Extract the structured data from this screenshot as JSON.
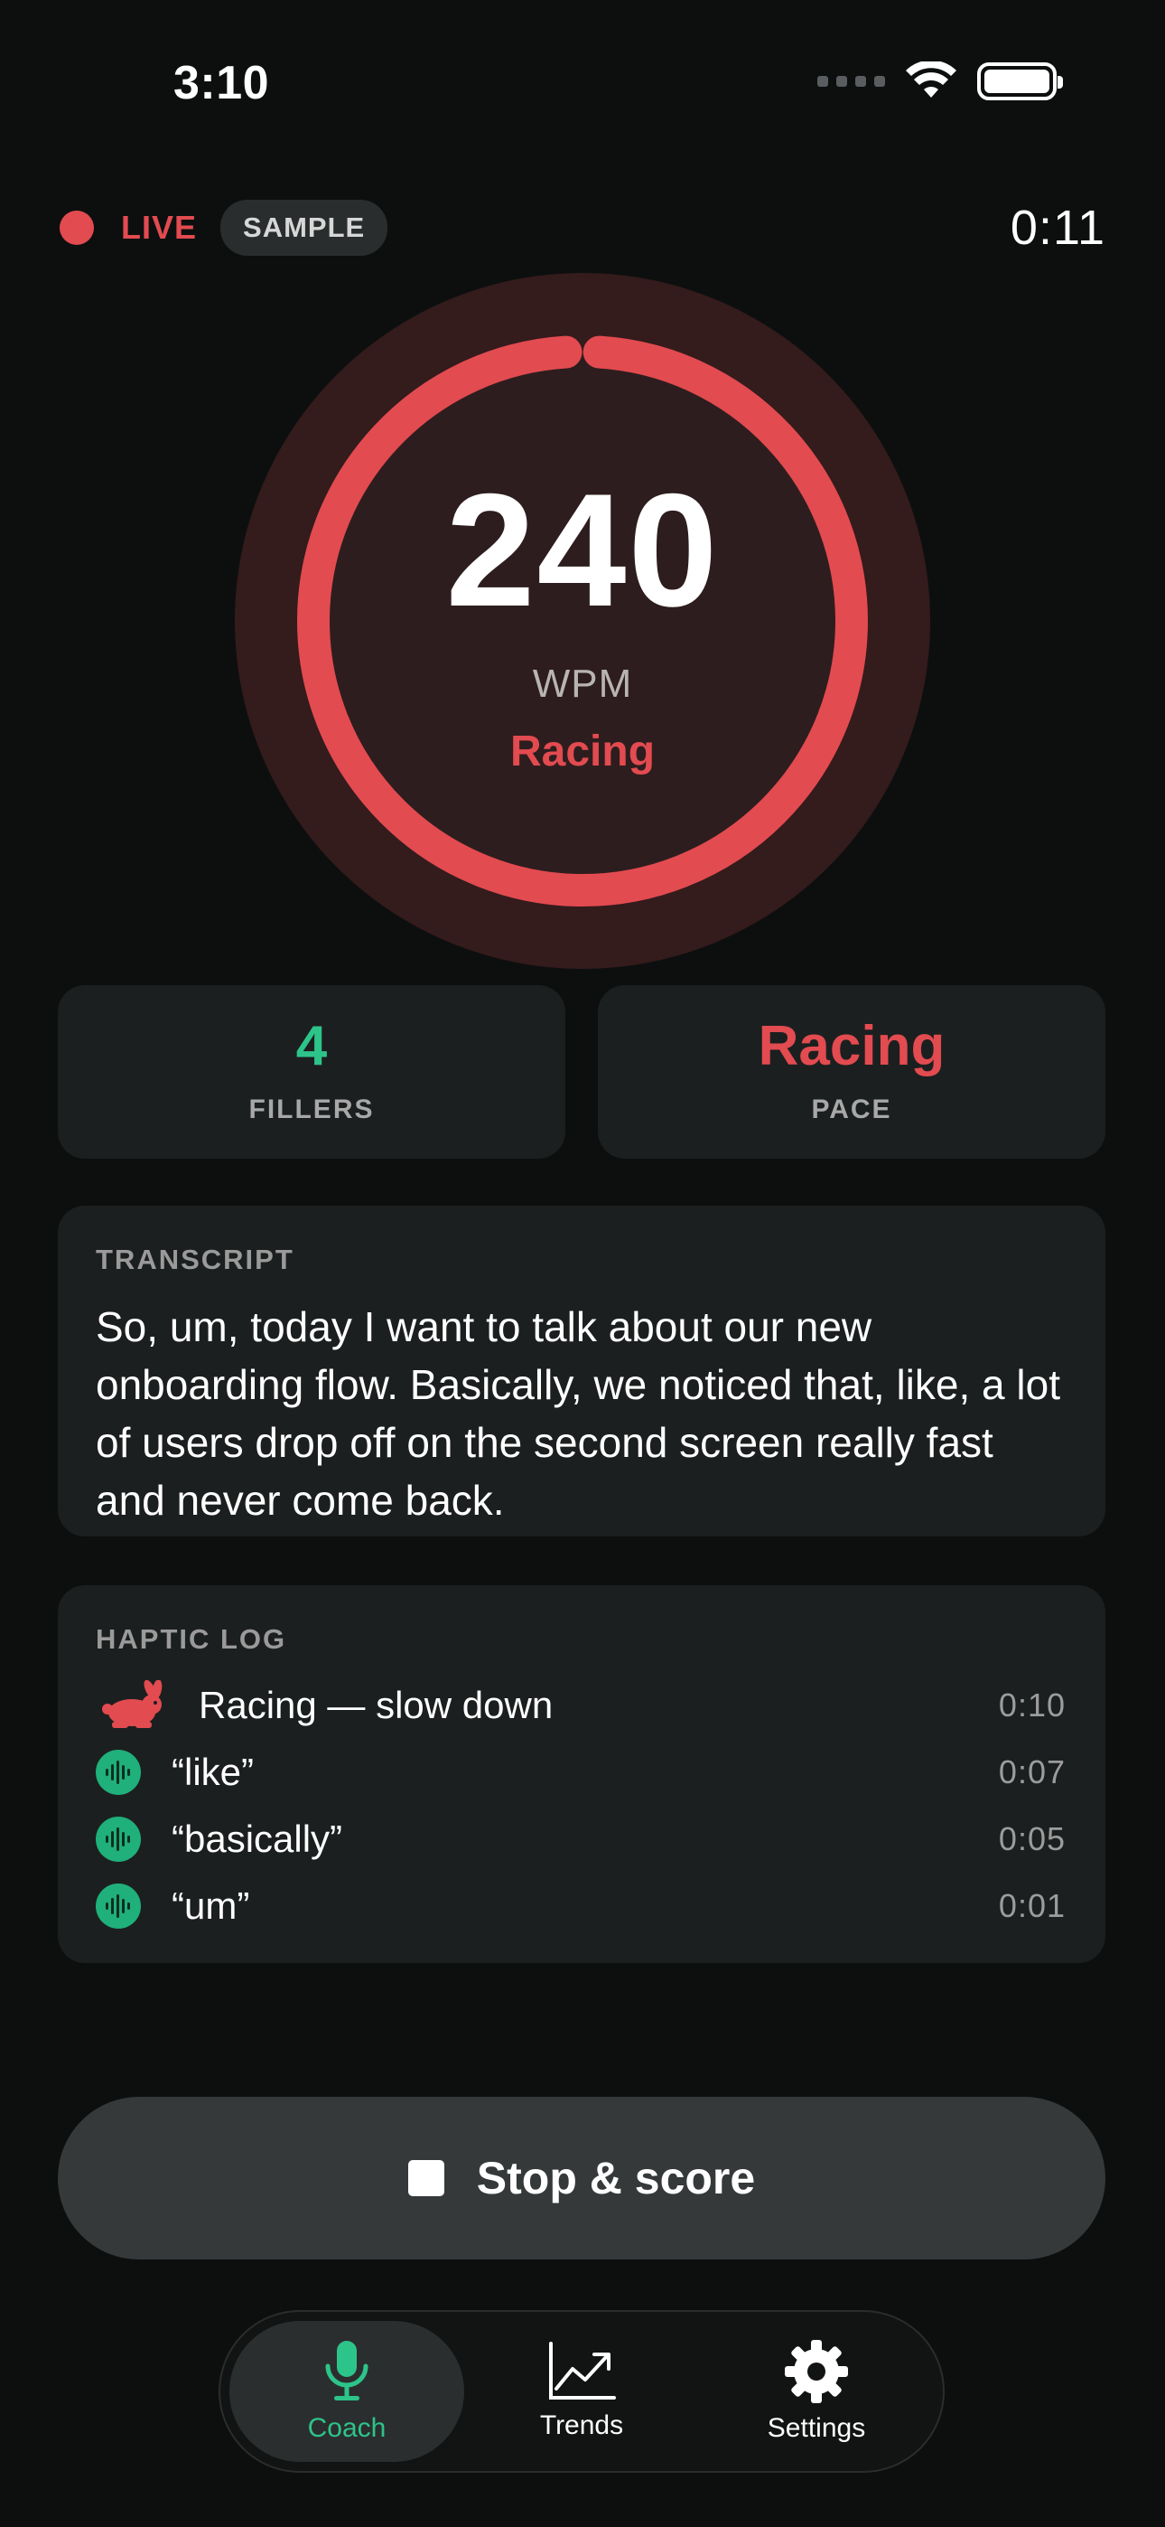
{
  "status_bar": {
    "time": "3:10"
  },
  "session": {
    "live_label": "LIVE",
    "sample_label": "SAMPLE",
    "elapsed": "0:11"
  },
  "gauge": {
    "wpm": "240",
    "unit": "WPM",
    "pace": "Racing",
    "fill_fraction": 0.98
  },
  "stats": {
    "fillers_value": "4",
    "fillers_label": "FILLERS",
    "pace_value": "Racing",
    "pace_label": "PACE"
  },
  "transcript": {
    "label": "TRANSCRIPT",
    "text": "So, um, today I want to talk about our new onboarding flow. Basically, we noticed that, like, a lot of users drop off on the second screen really fast and never come back."
  },
  "haptic_log": {
    "label": "HAPTIC LOG",
    "items": [
      {
        "icon": "rabbit-icon",
        "text": "Racing — slow down",
        "time": "0:10"
      },
      {
        "icon": "waveform-icon",
        "text": "“like”",
        "time": "0:07"
      },
      {
        "icon": "waveform-icon",
        "text": "“basically”",
        "time": "0:05"
      },
      {
        "icon": "waveform-icon",
        "text": "“um”",
        "time": "0:01"
      }
    ]
  },
  "stop_button": {
    "label": "Stop & score",
    "icon": "stop-icon"
  },
  "tabs": [
    {
      "label": "Coach",
      "icon": "microphone-icon",
      "active": true
    },
    {
      "label": "Trends",
      "icon": "chart-trend-icon",
      "active": false
    },
    {
      "label": "Settings",
      "icon": "gear-icon",
      "active": false
    }
  ],
  "colors": {
    "background": "#0d0f0f",
    "card": "#1c1f1f",
    "accent_red": "#e24b50",
    "accent_green": "#2dc48a",
    "gauge_bg": "#341b1c"
  }
}
